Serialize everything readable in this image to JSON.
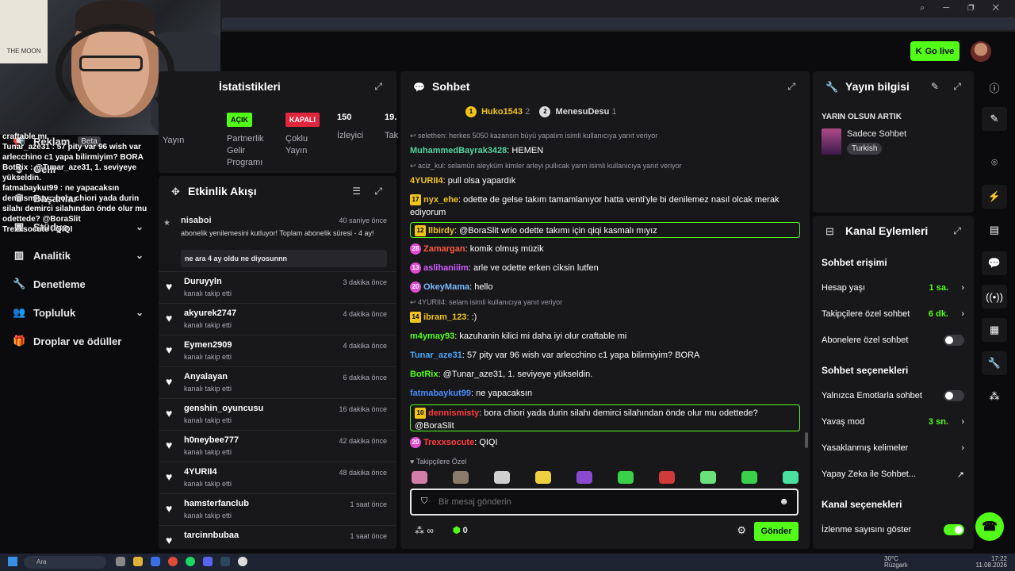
{
  "browser": {
    "top_icons": "⌕ ─ ❐ ✕"
  },
  "header": {
    "go_live": "Go live"
  },
  "webcam": {
    "poster_text": "THE MOON"
  },
  "overlay_chat": [
    {
      "text": "craftable mı"
    },
    {
      "text": "Tunar_aze31 : 57 pity var 96 wish var arlecchino c1 yapa bilirmiyim? BORA"
    },
    {
      "text": "BotRix : @Tunar_aze31, 1. seviyeye yükseldin."
    },
    {
      "text": "fatmabaykut99 : ne yapacaksın"
    },
    {
      "text": "dennismisty : bora chiori yada durin silahı demirci silahından önde olur mu odettede? @BoraSlit"
    },
    {
      "text": "Trexxsocute : QIQI"
    }
  ],
  "leftnav": {
    "items": [
      {
        "label": "Reklam",
        "badge": "Beta",
        "icon": "megaphone-icon"
      },
      {
        "label": "Gelir",
        "icon": "money-icon"
      },
      {
        "label": "Başarılar",
        "icon": "trophy-icon"
      },
      {
        "label": "Stüdyo",
        "icon": "studio-icon"
      },
      {
        "label": "Analitik",
        "icon": "chart-icon"
      },
      {
        "label": "Denetleme",
        "icon": "wrench-icon"
      },
      {
        "label": "Topluluk",
        "icon": "users-icon"
      },
      {
        "label": "Droplar ve ödüller",
        "icon": "gift-icon"
      }
    ]
  },
  "stats": {
    "title": "İstatistikleri",
    "col1_label": "Yayın",
    "acik_badge": "AÇIK",
    "acik_label": "Partnerlik Gelir Programı",
    "kapali_badge": "KAPALI",
    "kapali_label": "Çoklu Yayın",
    "viewers_value": "150",
    "viewers_label": "İzleyici",
    "extra_value": "19.",
    "extra_label": "Tak"
  },
  "activity": {
    "title": "Etkinlik Akışı",
    "top": {
      "name": "nisaboi",
      "time": "40 saniye önce",
      "message": "abonelik yenilemesini kutluyor! Toplam abonelik süresi - 4 ay!",
      "quote": "ne ara 4 ay oldu ne diyosunnn"
    },
    "rows": [
      {
        "name": "Duruyyln",
        "sub": "kanalı takip etti",
        "time": "3 dakika önce"
      },
      {
        "name": "akyurek2747",
        "sub": "kanalı takip etti",
        "time": "4 dakika önce"
      },
      {
        "name": "Eymen2909",
        "sub": "kanalı takip etti",
        "time": "4 dakika önce"
      },
      {
        "name": "Anyalayan",
        "sub": "kanalı takip etti",
        "time": "6 dakika önce"
      },
      {
        "name": "genshin_oyuncusu",
        "sub": "kanalı takip etti",
        "time": "16 dakika önce"
      },
      {
        "name": "h0neybee777",
        "sub": "kanalı takip etti",
        "time": "42 dakika önce"
      },
      {
        "name": "4YURII4",
        "sub": "kanalı takip etti",
        "time": "48 dakika önce"
      },
      {
        "name": "hamsterfanclub",
        "sub": "kanalı takip etti",
        "time": "1 saat önce"
      },
      {
        "name": "tarcinnbubaa",
        "sub": "",
        "time": "1 saat önce"
      }
    ]
  },
  "chat": {
    "title": "Sohbet",
    "leader1": {
      "name": "Huko1543",
      "count": "2",
      "rank": "1"
    },
    "leader2": {
      "name": "MenesuDesu",
      "count": "1",
      "rank": "2"
    },
    "messages": [
      {
        "reply": "selethen: herkes 5050 kazansın büyü yapalım isimli kullanıcıya yanıt veriyor",
        "user": "MuhammedBayrak3428",
        "text": ": HEMEN",
        "color": "#53d6a0"
      },
      {
        "reply": "aciz_kul: selamün aleyküm kimler arleyi pullıcak yarın isimli kullanıcıya yanıt veriyor",
        "user": "4YURII4",
        "text": ": pull olsa yapardık",
        "color": "#f0c419"
      },
      {
        "level": "17",
        "user": "nyx_ehe",
        "text": ": odette de gelse takım tamamlanıyor hatta venti'yle bi denilemez nasıl olcak merak ediyorum",
        "color": "#f0c419"
      },
      {
        "level": "12",
        "user": "llbirdy",
        "text": ": @BoraSlit wrio odette takımı için qiqi kasmalı mıyız",
        "color": "#f0c419",
        "highlight": true
      },
      {
        "level": "28",
        "user": "Zamargan",
        "text": ": komik olmuş müzik",
        "color": "#ff5a3c"
      },
      {
        "level": "13",
        "user": "aslihaniiim",
        "text": ": arle ve odette erken ciksin lutfen",
        "color": "#d05bff"
      },
      {
        "level": "20",
        "user": "OkeyMama",
        "text": ": hello",
        "color": "#7ab8ff"
      },
      {
        "reply": "4YURII4: selam isimli kullanıcıya yanıt veriyor",
        "level": "14",
        "user": "ibram_123",
        "text": ": :)",
        "color": "#f0c419"
      },
      {
        "user": "m4ymay93",
        "text": ": kazuhanin kilici mi daha iyi olur craftable mi",
        "color": "#53fc18"
      },
      {
        "user": "Tunar_aze31",
        "text": ": 57 pity var 96 wish var arlecchino c1 yapa bilirmiyim? BORA",
        "color": "#4aa8ff"
      },
      {
        "user": "BotRix",
        "text": ": @Tunar_aze31, 1. seviyeye yükseldin.",
        "color": "#53fc18"
      },
      {
        "user": "fatmabaykut99",
        "text": ": ne yapacaksın",
        "color": "#4a8cff"
      },
      {
        "level": "10",
        "user": "dennismisty",
        "text": ": bora chiori yada durin silahı demirci silahından önde olur mu odettede? @BoraSlit",
        "color": "#ff3c3c",
        "highlight": true
      },
      {
        "level": "20",
        "user": "Trexxsocute",
        "text": ": QIQI",
        "color": "#ff3c3c"
      }
    ],
    "followers_only": "Takipçilere Özel",
    "input_placeholder": "Bir mesaj gönderin",
    "points": "0",
    "send": "Gönder"
  },
  "streaminfo": {
    "title": "Yayın bilgisi",
    "stream_title": "YARIN OLSUN ARTIK",
    "category": "Sadece Sohbet",
    "language": "Turkish"
  },
  "channel": {
    "title": "Kanal Eylemleri",
    "chat_access": "Sohbet erişimi",
    "account_age": {
      "label": "Hesap yaşı",
      "value": "1 sa."
    },
    "followers_chat": {
      "label": "Takipçilere özel sohbet",
      "value": "6 dk."
    },
    "subs_chat": {
      "label": "Abonelere özel sohbet"
    },
    "chat_options": "Sohbet seçenekleri",
    "emotes_only": {
      "label": "Yalnızca Emotlarla sohbet"
    },
    "slow_mode": {
      "label": "Yavaş mod",
      "value": "3 sn."
    },
    "banned_words": {
      "label": "Yasaklanmış kelimeler"
    },
    "ai_chat": {
      "label": "Yapay Zeka ile Sohbet..."
    },
    "channel_options": "Kanal seçenekleri",
    "show_viewers": {
      "label": "İzlenme sayısını göster"
    }
  },
  "taskbar": {
    "search": "Ara",
    "weather_temp": "30°C",
    "weather_desc": "Rüzgarlı",
    "time": "17:22",
    "date": "11.08.2026"
  },
  "colors": {
    "accent": "#53fc18",
    "panel": "#18181b",
    "background": "#0b0b0d"
  }
}
